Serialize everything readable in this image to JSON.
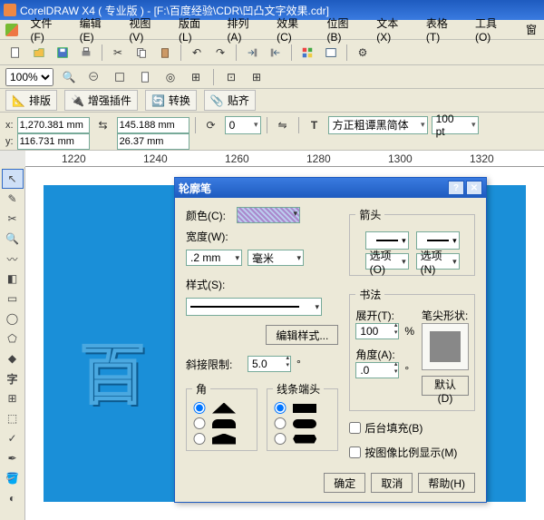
{
  "titlebar": "CorelDRAW X4 ( 专业版 ) - [F:\\百度经验\\CDR\\凹凸文字效果.cdr]",
  "menu": [
    "文件(F)",
    "编辑(E)",
    "视图(V)",
    "版面(L)",
    "排列(A)",
    "效果(C)",
    "位图(B)",
    "文本(X)",
    "表格(T)",
    "工具(O)",
    "窗"
  ],
  "zoom": "100%",
  "tabs": {
    "layout": "排版",
    "plugin": "增强插件",
    "convert": "转换",
    "align": "贴齐"
  },
  "props": {
    "x_lbl": "x:",
    "x_val": "1,270.381 mm",
    "y_lbl": "y:",
    "y_val": "116.731 mm",
    "w_val": "145.188 mm",
    "h_val": "26.37 mm",
    "rot": "0",
    "font": "方正粗谭黑简体",
    "fontsize": "100 pt"
  },
  "ruler": {
    "t0": "1220",
    "t1": "1240",
    "t2": "1260",
    "t3": "1280",
    "t4": "1300",
    "t5": "1320"
  },
  "canvas_text": "百",
  "dlg": {
    "title": "轮廓笔",
    "color_lbl": "颜色(C):",
    "width_lbl": "宽度(W):",
    "width_val": ".2 mm",
    "width_unit": "毫米",
    "style_lbl": "样式(S):",
    "edit_style": "编辑样式...",
    "miter_lbl": "斜接限制:",
    "miter_val": "5.0",
    "miter_deg": "°",
    "corner_lbl": "角",
    "endcap_lbl": "线条端头",
    "arrow_lbl": "箭头",
    "opt1": "选项(O)",
    "opt2": "选项(N)",
    "callig_lbl": "书法",
    "stretch_lbl": "展开(T):",
    "stretch_val": "100",
    "pct": "%",
    "angle_lbl": "角度(A):",
    "angle_val": ".0",
    "nib_lbl": "笔尖形状:",
    "default_btn": "默认(D)",
    "behind_fill": "后台填充(B)",
    "scale_img": "按图像比例显示(M)",
    "ok": "确定",
    "cancel": "取消",
    "help": "帮助(H)"
  }
}
